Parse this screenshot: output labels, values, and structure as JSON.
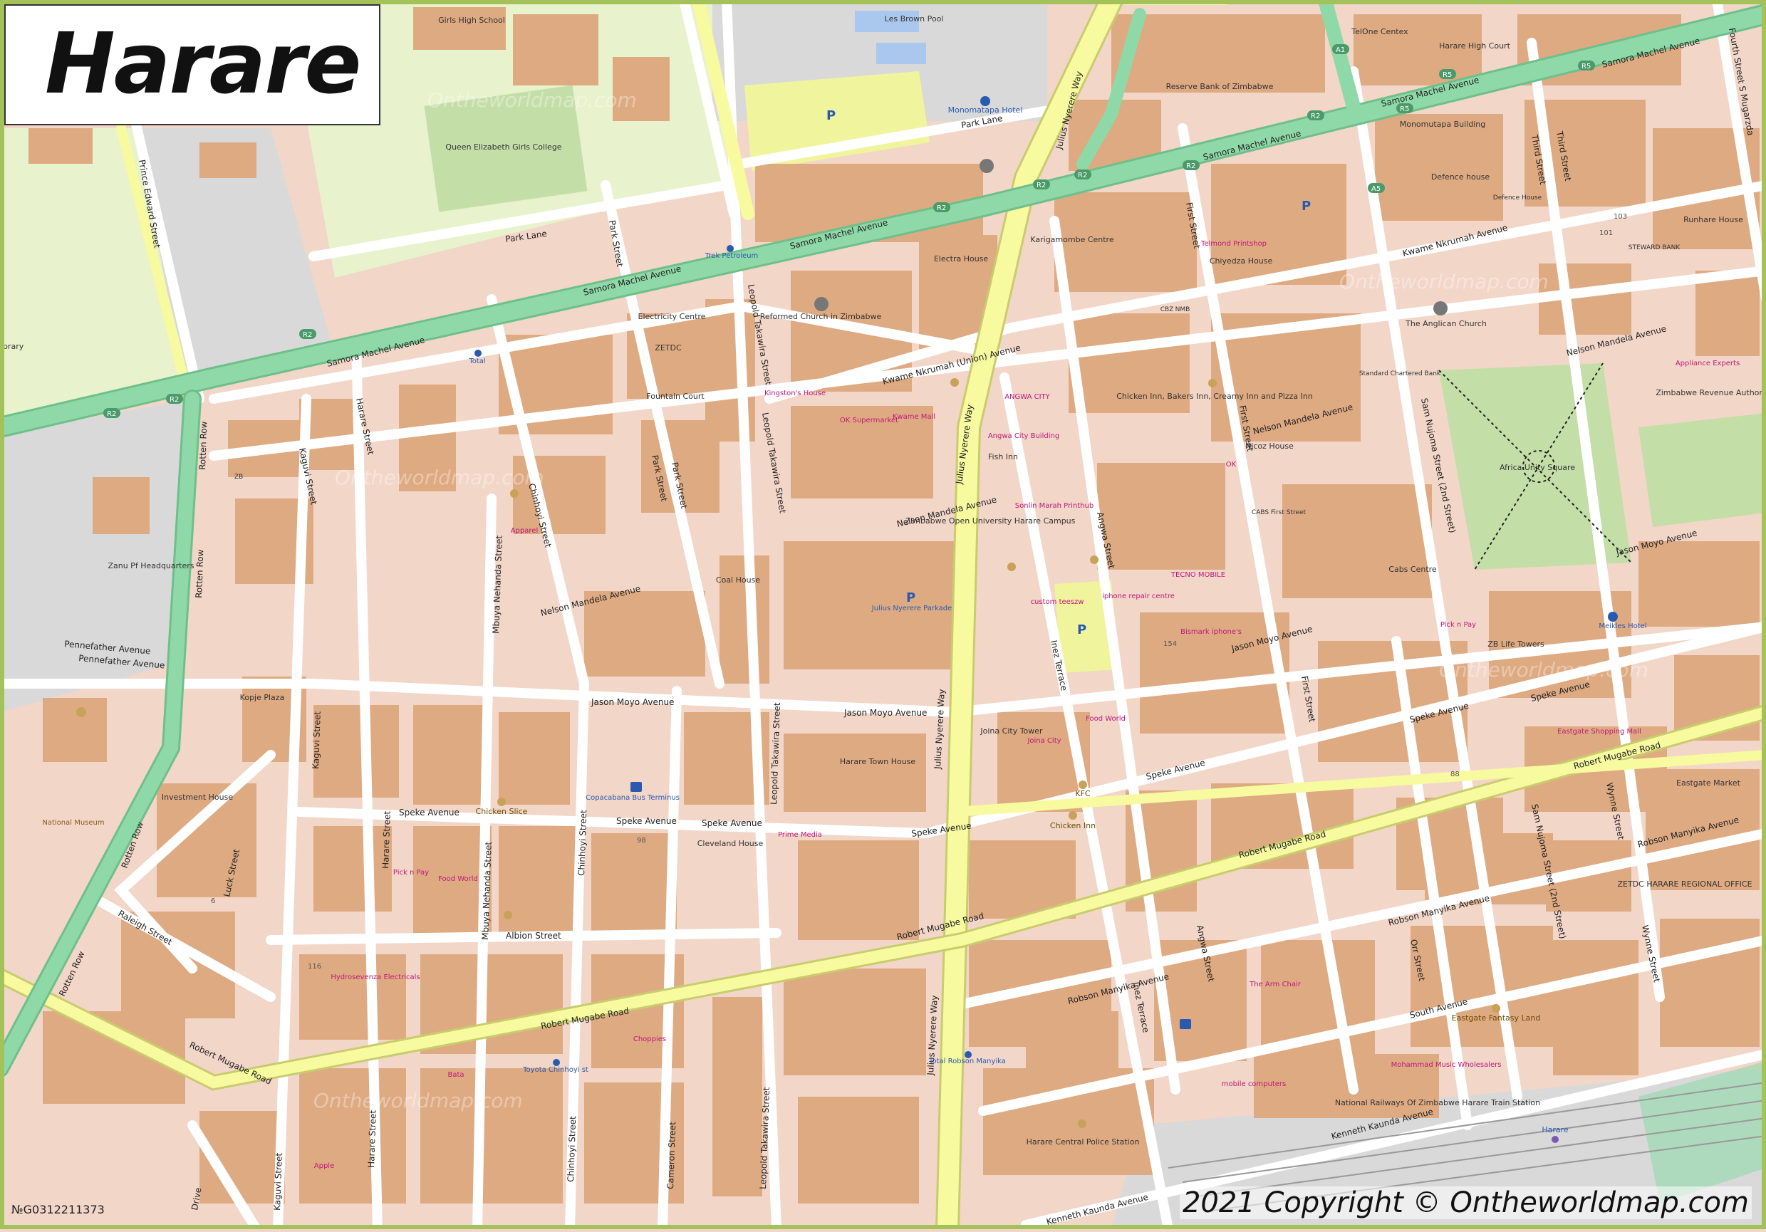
{
  "title": "Harare",
  "copyright": "2021 Copyright © Ontheworldmap.com",
  "map_id": "№G0312211373",
  "watermark": "Ontheworldmap.com",
  "colors": {
    "background": "#f2d6c8",
    "building": "#deaa82",
    "primary_road": "#8fd9a8",
    "primary_road_casing": "#6fbf8a",
    "trunk_road": "#f7fa9e",
    "trunk_casing": "#c9cc6e",
    "minor_road": "#ffffff",
    "park": "#e8f2cc",
    "green": "#c4dea8",
    "grey_area": "#d9d9d9",
    "parking": "#f0f49c",
    "label": "#333333",
    "poi": "#c0187a"
  },
  "road_names": {
    "samora_machel": "Samora Machel Avenue",
    "julius_nyerere": "Julius Nyerere Way",
    "park_lane": "Park Lane",
    "kwame_nkrumah_union": "Kwame Nkrumah (Union) Avenue",
    "kwame_nkrumah": "Kwame Nkrumah Avenue",
    "nelson_mandela": "Nelson Mandela Avenue",
    "jason_moyo": "Jason Moyo Avenue",
    "speke": "Speke Avenue",
    "albion": "Albion Street",
    "robert_mugabe": "Robert Mugabe Road",
    "robson_manyika": "Robson Manyika Avenue",
    "south": "South Avenue",
    "kenneth_kaunda": "Kenneth Kaunda Avenue",
    "pennefather": "Pennefather Avenue",
    "rotten_row": "Rotten Row",
    "leopold_takawira": "Leopold Takawira Street",
    "harare_street": "Harare Street",
    "kaguvi": "Kaguvi Street",
    "chinhoyi": "Chinhoyi Street",
    "mbuya_nehanda": "Mbuya Nehanda Street",
    "park_street": "Park Street",
    "cameron": "Cameron Street",
    "inez_terrace": "Inez Terrace",
    "angwa": "Angwa Street",
    "first_street": "First Street",
    "sam_nujoma": "Sam Nujoma Street (2nd Street)",
    "third_street": "Third Street",
    "fourth_street": "Fourth Street S Mugarzda",
    "orr": "Orr Street",
    "wynne": "Wynne Street",
    "luck": "Luck Street",
    "raleigh": "Raleigh Street",
    "prince_edward": "Prince Edward Street",
    "drive": "Drive",
    "speke_avenue_east": "Speke Avenue"
  },
  "shields": [
    "R2",
    "R5",
    "A1",
    "A5"
  ],
  "places": [
    {
      "name": "Girls High School"
    },
    {
      "name": "Les Brown Pool"
    },
    {
      "name": "Queen Elizabeth Girls College"
    },
    {
      "name": "Monomatapa Hotel"
    },
    {
      "name": "Reserve Bank of Zimbabwe"
    },
    {
      "name": "TelOne Centex"
    },
    {
      "name": "Harare High Court"
    },
    {
      "name": "Monomutapa Building"
    },
    {
      "name": "Defence house"
    },
    {
      "name": "Defence House"
    },
    {
      "name": "Runhare House"
    },
    {
      "name": "STEWARD BANK"
    },
    {
      "name": "Trek Petroleum"
    },
    {
      "name": "Electra House"
    },
    {
      "name": "Karigamombe Centre"
    },
    {
      "name": "Chiyedza House"
    },
    {
      "name": "Telmond Printshop"
    },
    {
      "name": "Reformed Church in Zimbabwe"
    },
    {
      "name": "Electricity Centre"
    },
    {
      "name": "ZETDC"
    },
    {
      "name": "Fountain Court"
    },
    {
      "name": "Kingston's House"
    },
    {
      "name": "OK Supermarket"
    },
    {
      "name": "Kwame Mall"
    },
    {
      "name": "ANGWA CITY"
    },
    {
      "name": "Angwa City Building"
    },
    {
      "name": "Fish Inn"
    },
    {
      "name": "CBZ"
    },
    {
      "name": "NMB"
    },
    {
      "name": "The Anglican Church"
    },
    {
      "name": "Standard Chartered Bank"
    },
    {
      "name": "Appliance Experts"
    },
    {
      "name": "Zimbabwe Revenue Authority"
    },
    {
      "name": "Chicken Inn, Bakers Inn, Creamy Inn and Pizza Inn"
    },
    {
      "name": "OK"
    },
    {
      "name": "Nicoz House"
    },
    {
      "name": "CABS First Street"
    },
    {
      "name": "Africa Unity Square"
    },
    {
      "name": "Total"
    },
    {
      "name": "ZB"
    },
    {
      "name": "Apparel"
    },
    {
      "name": "Zanu Pf Headquarters"
    },
    {
      "name": "Coal House"
    },
    {
      "name": "Julius Nyerere Parkade"
    },
    {
      "name": "Zimbabwe Open University Harare Campus"
    },
    {
      "name": "Sonlin Marah Printhub"
    },
    {
      "name": "custom teeszw"
    },
    {
      "name": "iphone repair centre"
    },
    {
      "name": "TECNO MOBILE"
    },
    {
      "name": "Bismark iphone's"
    },
    {
      "name": "Cabs Centre"
    },
    {
      "name": "Pick n Pay"
    },
    {
      "name": "Meikles Hotel"
    },
    {
      "name": "ZB Life Towers"
    },
    {
      "name": "Kopje Plaza"
    },
    {
      "name": "Food World"
    },
    {
      "name": "Joina City Tower"
    },
    {
      "name": "Joina City"
    },
    {
      "name": "Harare Town House"
    },
    {
      "name": "Eastgate Shopping Mall"
    },
    {
      "name": "Eastgate Market"
    },
    {
      "name": "Investment House"
    },
    {
      "name": "National Museum"
    },
    {
      "name": "Chicken Slice"
    },
    {
      "name": "Copacabana Bus Terminus"
    },
    {
      "name": "Cleveland House"
    },
    {
      "name": "Prime Media"
    },
    {
      "name": "KFC"
    },
    {
      "name": "Chicken Inn"
    },
    {
      "name": "Pick n Pay"
    },
    {
      "name": "Food World"
    },
    {
      "name": "ZETDC HARARE REGIONAL OFFICE"
    },
    {
      "name": "Hydrosevenza Electricals"
    },
    {
      "name": "Choppies"
    },
    {
      "name": "Bata"
    },
    {
      "name": "Toyota Chinhoyi st"
    },
    {
      "name": "Total Robson Manyika"
    },
    {
      "name": "The Arm Chair"
    },
    {
      "name": "Eastgate Fantasy Land"
    },
    {
      "name": "Mohammad Music Wholesalers"
    },
    {
      "name": "Harare Central Police Station"
    },
    {
      "name": "mobile computers"
    },
    {
      "name": "National Railways Of Zimbabwe Harare Train Station"
    },
    {
      "name": "Harare"
    },
    {
      "name": "Library"
    },
    {
      "name": "Apple"
    }
  ],
  "house_numbers": [
    "103",
    "101",
    "98",
    "116",
    "154",
    "6",
    "88"
  ],
  "parking_label": "P"
}
